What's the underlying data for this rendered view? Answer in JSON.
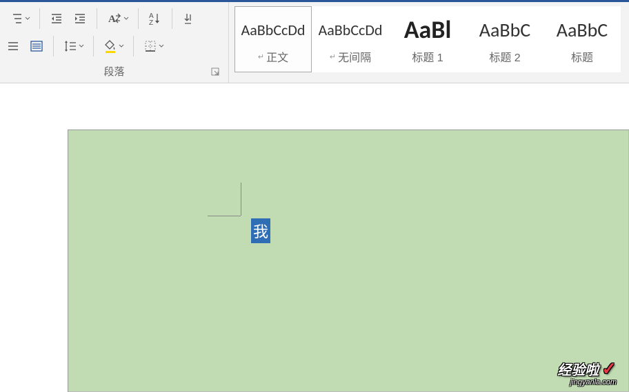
{
  "ribbon": {
    "paragraph_label": "段落"
  },
  "styles": [
    {
      "preview": "AaBbCcDd",
      "name": "正文",
      "marker": "↵",
      "class": "normal",
      "selected": true
    },
    {
      "preview": "AaBbCcDd",
      "name": "无间隔",
      "marker": "↵",
      "class": "normal",
      "selected": false
    },
    {
      "preview": "AaBl",
      "name": "标题 1",
      "marker": "",
      "class": "heading1",
      "selected": false
    },
    {
      "preview": "AaBbC",
      "name": "标题 2",
      "marker": "",
      "class": "heading2",
      "selected": false
    },
    {
      "preview": "AaBbC",
      "name": "标题",
      "marker": "",
      "class": "heading3",
      "selected": false
    }
  ],
  "document": {
    "selected_text": "我"
  },
  "watermark": {
    "main": "经验啦",
    "sub": "jingyanla.com"
  }
}
